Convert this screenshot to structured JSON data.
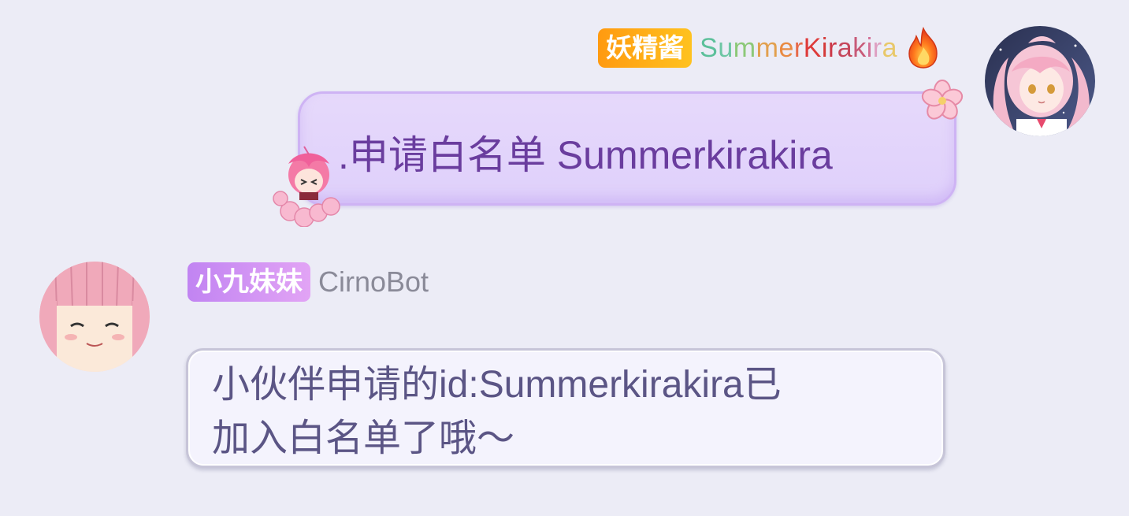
{
  "message_1": {
    "sender_badge": "妖精酱",
    "sender_name_chars": [
      "S",
      "u",
      "m",
      "m",
      "e",
      "r",
      "K",
      "i",
      "r",
      "a",
      "k",
      "i",
      "r",
      "a"
    ],
    "sender_name_colors": [
      "#5cc09a",
      "#6ec6a4",
      "#8cc878",
      "#e2a04e",
      "#e98a42",
      "#e66a4a",
      "#de3b3b",
      "#d43a3a",
      "#cc3848",
      "#c6475c",
      "#c85a78",
      "#d36f96",
      "#dea0c2",
      "#e8c86a"
    ],
    "text": ".申请白名单 Summerkirakira",
    "icon": "fire-icon"
  },
  "message_2": {
    "sender_badge": "小九妹妹",
    "sender_name": "CirnoBot",
    "text_line_1": "小伙伴申请的id:Summerkirakira已",
    "text_line_2": "加入白名单了哦～"
  },
  "colors": {
    "background": "#ececf6",
    "badge_orange": "#ffa415",
    "badge_purple": "#c78af3",
    "bubble_purple_text": "#6a3d9e",
    "bubble_gray_text": "#5b5585"
  }
}
